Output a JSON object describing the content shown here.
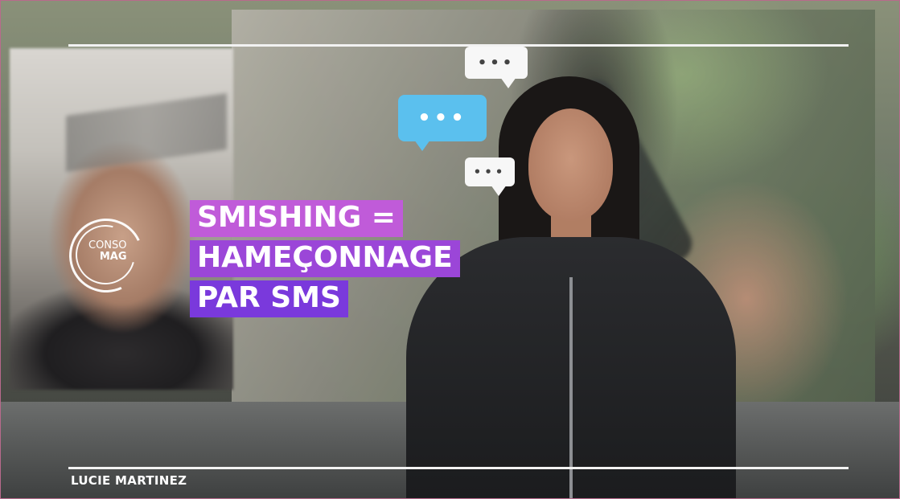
{
  "title": {
    "line1": "SMISHING =",
    "line2": "HAMEÇONNAGE",
    "line3": "PAR SMS"
  },
  "logo": {
    "top": "CONSO",
    "bottom": "MAG"
  },
  "presenter_name": "LUCIE MARTINEZ",
  "bubbles": {
    "b1": "•••",
    "b2": "•••",
    "b3": "•••"
  },
  "colors": {
    "title_line1": "#c05bd9",
    "title_line2": "#9b46d8",
    "title_line3": "#7a39dc",
    "bubble_blue": "#5bc0ee",
    "bubble_white": "#f7f7f7"
  }
}
